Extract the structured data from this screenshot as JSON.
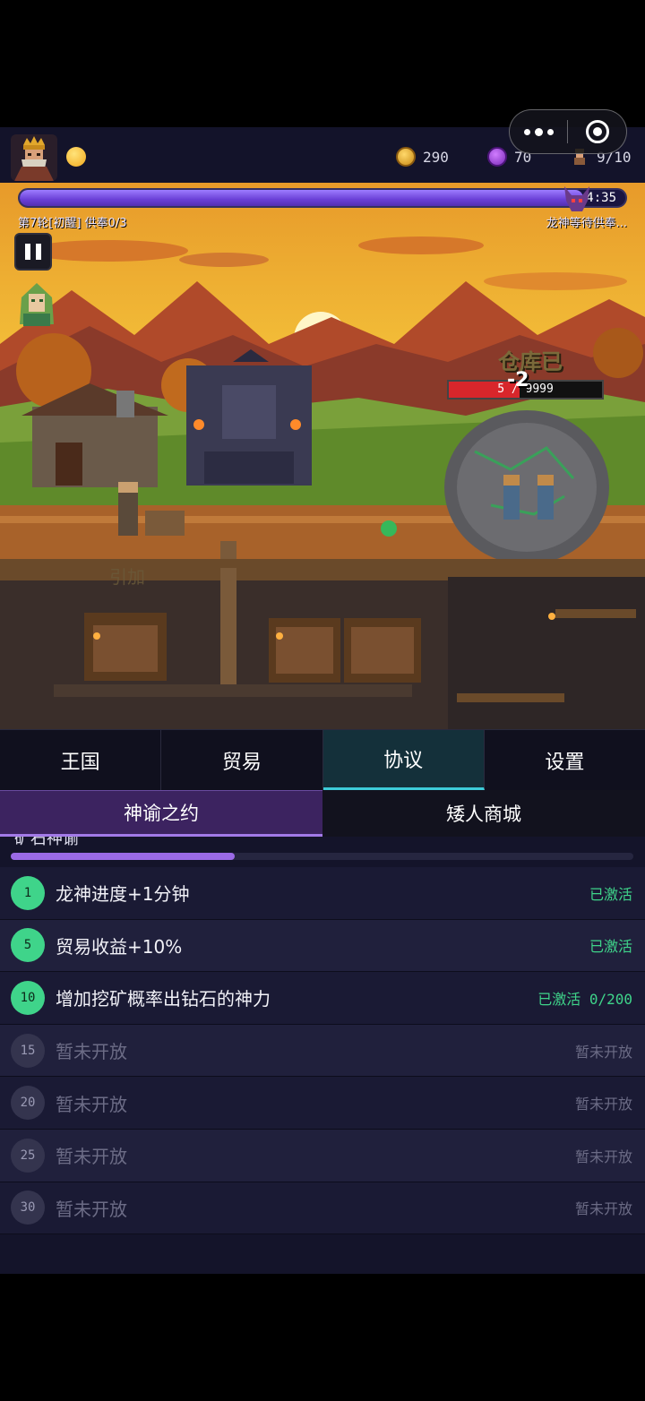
{
  "header": {
    "gold": "290",
    "gems": "70",
    "workers": "9/10"
  },
  "round": {
    "timer": "4:35",
    "progress": 0.93,
    "round_label": "第7轮[初醒] 供奉0/3",
    "dragon_status": "龙神等待供奉..."
  },
  "scene": {
    "warehouse_label": "仓库已",
    "damage_float": "-2",
    "boulder_hp": "5 / 9999",
    "boulder_hp_fraction": 0.46,
    "sign_text": "引加"
  },
  "tabs": [
    {
      "label": "王国"
    },
    {
      "label": "贸易"
    },
    {
      "label": "协议"
    },
    {
      "label": "设置"
    }
  ],
  "subtabs": [
    {
      "label": "神谕之约"
    },
    {
      "label": "矮人商城"
    }
  ],
  "panel": {
    "section_title": "矿石神谕",
    "progress_fraction": 0.36,
    "rows": [
      {
        "level": "1",
        "label": "龙神进度+1分钟",
        "state": "已激活",
        "status": "active"
      },
      {
        "level": "5",
        "label": "贸易收益+10%",
        "state": "已激活",
        "status": "active"
      },
      {
        "level": "10",
        "label": "增加挖矿概率出钻石的神力",
        "state": "已激活 0/200",
        "status": "active"
      },
      {
        "level": "15",
        "label": "暂未开放",
        "state": "暂未开放",
        "status": "locked"
      },
      {
        "level": "20",
        "label": "暂未开放",
        "state": "暂未开放",
        "status": "locked"
      },
      {
        "level": "25",
        "label": "暂未开放",
        "state": "暂未开放",
        "status": "locked"
      },
      {
        "level": "30",
        "label": "暂未开放",
        "state": "暂未开放",
        "status": "locked"
      }
    ]
  },
  "colors": {
    "accent_teal": "#3dcbd8",
    "accent_purple": "#9b6ae6",
    "active_green": "#3fd48a"
  }
}
